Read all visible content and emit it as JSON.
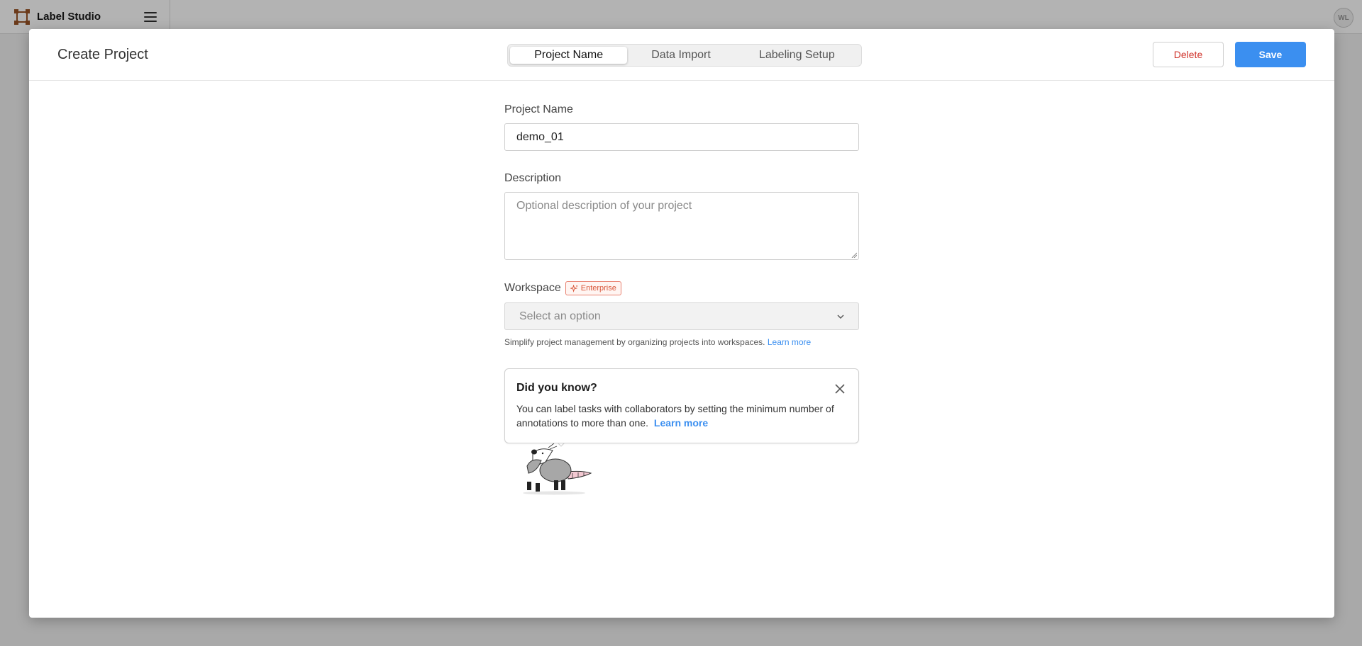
{
  "app": {
    "brand_name": "Label Studio",
    "avatar_initials": "WL"
  },
  "modal": {
    "title": "Create Project",
    "tabs": [
      {
        "label": "Project Name",
        "active": true
      },
      {
        "label": "Data Import",
        "active": false
      },
      {
        "label": "Labeling Setup",
        "active": false
      }
    ],
    "delete_label": "Delete",
    "save_label": "Save"
  },
  "form": {
    "project_name": {
      "label": "Project Name",
      "value": "demo_01"
    },
    "description": {
      "label": "Description",
      "placeholder": "Optional description of your project"
    },
    "workspace": {
      "label": "Workspace",
      "badge": "Enterprise",
      "select_placeholder": "Select an option",
      "hint": "Simplify project management by organizing projects into workspaces.",
      "hint_link": "Learn more"
    }
  },
  "tip": {
    "title": "Did you know?",
    "body": "You can label tasks with collaborators by setting the minimum number of annotations to more than one.",
    "link": "Learn more"
  },
  "colors": {
    "accent": "#3b8ff0",
    "danger": "#d0342c",
    "enterprise": "#d9583c",
    "overlay": "#a9a9a9"
  },
  "icons": {
    "brand": "label-studio-logo-icon",
    "menu": "hamburger-menu-icon",
    "dropdown": "chevron-down-icon",
    "close": "close-icon",
    "enterprise": "sparkle-icon",
    "mascot": "opossum-mascot-icon"
  }
}
